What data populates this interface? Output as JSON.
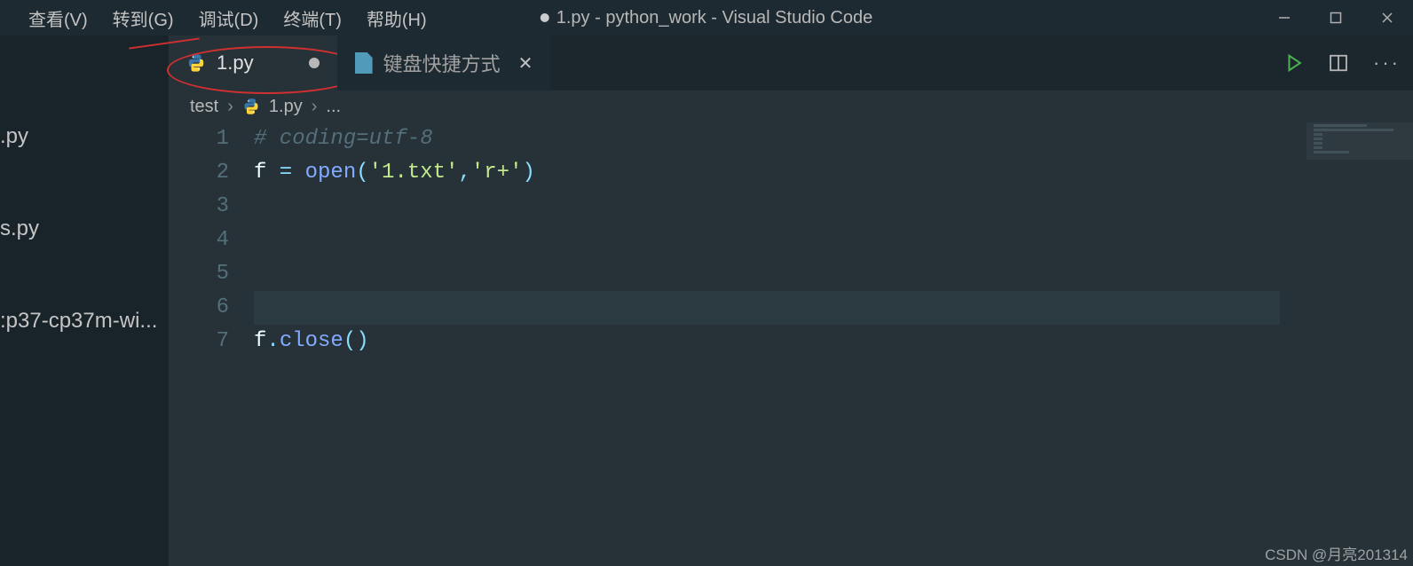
{
  "menu": {
    "view": "查看(V)",
    "goto": "转到(G)",
    "debug": "调试(D)",
    "terminal": "终端(T)",
    "help": "帮助(H)"
  },
  "window": {
    "title": "1.py - python_work - Visual Studio Code",
    "unsaved": true
  },
  "sidebar": {
    "items": [
      ".py",
      "s.py",
      ":p37-cp37m-wi..."
    ]
  },
  "tabs": [
    {
      "label": "1.py",
      "icon": "python-icon",
      "dirty": true,
      "active": true
    },
    {
      "label": "键盘快捷方式",
      "icon": "file-icon",
      "dirty": false,
      "active": false
    }
  ],
  "breadcrumb": {
    "seg0": "test",
    "seg1": "1.py",
    "seg2": "..."
  },
  "code": {
    "line_count": 7,
    "current_line": 6,
    "lines": {
      "1": {
        "comment": "# coding=utf-8"
      },
      "2": {
        "var": "f",
        "assign": " = ",
        "fn": "open",
        "lp": "(",
        "s1": "'1.txt'",
        "comma": ",",
        "s2": "'r+'",
        "rp": ")"
      },
      "7": {
        "obj": "f",
        "dot": ".",
        "method": "close",
        "lp": "(",
        "rp": ")"
      }
    }
  },
  "watermark": "CSDN @月亮201314"
}
